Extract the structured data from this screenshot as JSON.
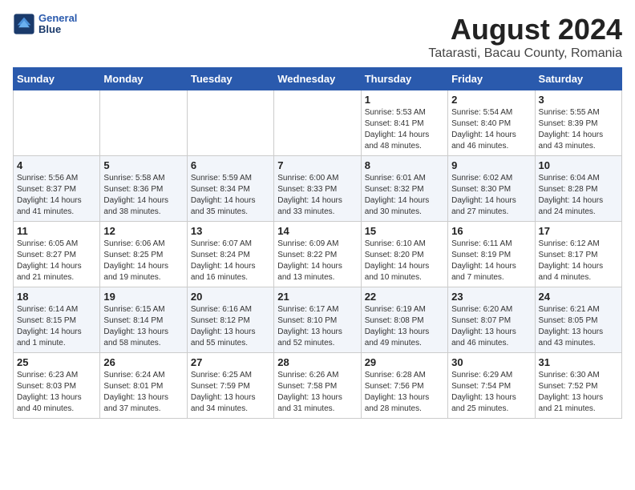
{
  "logo": {
    "line1": "General",
    "line2": "Blue"
  },
  "title": "August 2024",
  "subtitle": "Tatarasti, Bacau County, Romania",
  "weekdays": [
    "Sunday",
    "Monday",
    "Tuesday",
    "Wednesday",
    "Thursday",
    "Friday",
    "Saturday"
  ],
  "weeks": [
    [
      {
        "day": "",
        "info": ""
      },
      {
        "day": "",
        "info": ""
      },
      {
        "day": "",
        "info": ""
      },
      {
        "day": "",
        "info": ""
      },
      {
        "day": "1",
        "info": "Sunrise: 5:53 AM\nSunset: 8:41 PM\nDaylight: 14 hours and 48 minutes."
      },
      {
        "day": "2",
        "info": "Sunrise: 5:54 AM\nSunset: 8:40 PM\nDaylight: 14 hours and 46 minutes."
      },
      {
        "day": "3",
        "info": "Sunrise: 5:55 AM\nSunset: 8:39 PM\nDaylight: 14 hours and 43 minutes."
      }
    ],
    [
      {
        "day": "4",
        "info": "Sunrise: 5:56 AM\nSunset: 8:37 PM\nDaylight: 14 hours and 41 minutes."
      },
      {
        "day": "5",
        "info": "Sunrise: 5:58 AM\nSunset: 8:36 PM\nDaylight: 14 hours and 38 minutes."
      },
      {
        "day": "6",
        "info": "Sunrise: 5:59 AM\nSunset: 8:34 PM\nDaylight: 14 hours and 35 minutes."
      },
      {
        "day": "7",
        "info": "Sunrise: 6:00 AM\nSunset: 8:33 PM\nDaylight: 14 hours and 33 minutes."
      },
      {
        "day": "8",
        "info": "Sunrise: 6:01 AM\nSunset: 8:32 PM\nDaylight: 14 hours and 30 minutes."
      },
      {
        "day": "9",
        "info": "Sunrise: 6:02 AM\nSunset: 8:30 PM\nDaylight: 14 hours and 27 minutes."
      },
      {
        "day": "10",
        "info": "Sunrise: 6:04 AM\nSunset: 8:28 PM\nDaylight: 14 hours and 24 minutes."
      }
    ],
    [
      {
        "day": "11",
        "info": "Sunrise: 6:05 AM\nSunset: 8:27 PM\nDaylight: 14 hours and 21 minutes."
      },
      {
        "day": "12",
        "info": "Sunrise: 6:06 AM\nSunset: 8:25 PM\nDaylight: 14 hours and 19 minutes."
      },
      {
        "day": "13",
        "info": "Sunrise: 6:07 AM\nSunset: 8:24 PM\nDaylight: 14 hours and 16 minutes."
      },
      {
        "day": "14",
        "info": "Sunrise: 6:09 AM\nSunset: 8:22 PM\nDaylight: 14 hours and 13 minutes."
      },
      {
        "day": "15",
        "info": "Sunrise: 6:10 AM\nSunset: 8:20 PM\nDaylight: 14 hours and 10 minutes."
      },
      {
        "day": "16",
        "info": "Sunrise: 6:11 AM\nSunset: 8:19 PM\nDaylight: 14 hours and 7 minutes."
      },
      {
        "day": "17",
        "info": "Sunrise: 6:12 AM\nSunset: 8:17 PM\nDaylight: 14 hours and 4 minutes."
      }
    ],
    [
      {
        "day": "18",
        "info": "Sunrise: 6:14 AM\nSunset: 8:15 PM\nDaylight: 14 hours and 1 minute."
      },
      {
        "day": "19",
        "info": "Sunrise: 6:15 AM\nSunset: 8:14 PM\nDaylight: 13 hours and 58 minutes."
      },
      {
        "day": "20",
        "info": "Sunrise: 6:16 AM\nSunset: 8:12 PM\nDaylight: 13 hours and 55 minutes."
      },
      {
        "day": "21",
        "info": "Sunrise: 6:17 AM\nSunset: 8:10 PM\nDaylight: 13 hours and 52 minutes."
      },
      {
        "day": "22",
        "info": "Sunrise: 6:19 AM\nSunset: 8:08 PM\nDaylight: 13 hours and 49 minutes."
      },
      {
        "day": "23",
        "info": "Sunrise: 6:20 AM\nSunset: 8:07 PM\nDaylight: 13 hours and 46 minutes."
      },
      {
        "day": "24",
        "info": "Sunrise: 6:21 AM\nSunset: 8:05 PM\nDaylight: 13 hours and 43 minutes."
      }
    ],
    [
      {
        "day": "25",
        "info": "Sunrise: 6:23 AM\nSunset: 8:03 PM\nDaylight: 13 hours and 40 minutes."
      },
      {
        "day": "26",
        "info": "Sunrise: 6:24 AM\nSunset: 8:01 PM\nDaylight: 13 hours and 37 minutes."
      },
      {
        "day": "27",
        "info": "Sunrise: 6:25 AM\nSunset: 7:59 PM\nDaylight: 13 hours and 34 minutes."
      },
      {
        "day": "28",
        "info": "Sunrise: 6:26 AM\nSunset: 7:58 PM\nDaylight: 13 hours and 31 minutes."
      },
      {
        "day": "29",
        "info": "Sunrise: 6:28 AM\nSunset: 7:56 PM\nDaylight: 13 hours and 28 minutes."
      },
      {
        "day": "30",
        "info": "Sunrise: 6:29 AM\nSunset: 7:54 PM\nDaylight: 13 hours and 25 minutes."
      },
      {
        "day": "31",
        "info": "Sunrise: 6:30 AM\nSunset: 7:52 PM\nDaylight: 13 hours and 21 minutes."
      }
    ]
  ]
}
